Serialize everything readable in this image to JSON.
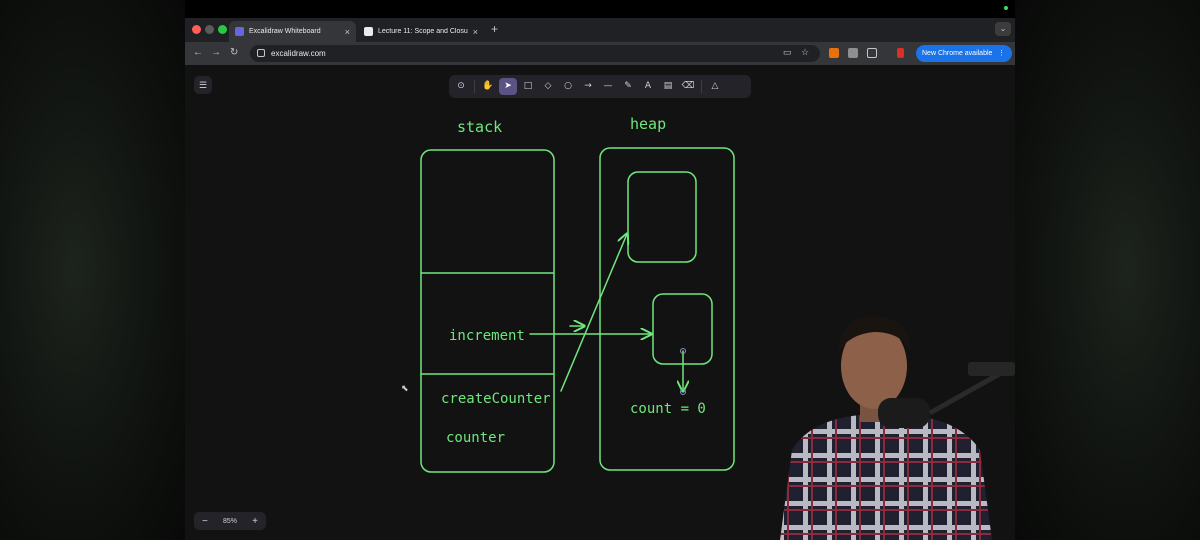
{
  "browser": {
    "tabs": [
      {
        "title": "Excalidraw Whiteboard",
        "active": true,
        "icon": "excalidraw-icon"
      },
      {
        "title": "Lecture 11: Scope and Closu",
        "active": false,
        "icon": "notion-icon"
      }
    ],
    "new_tab": "+",
    "url": "excalidraw.com",
    "update_button": "New Chrome available"
  },
  "excalidraw": {
    "menu_icon": "hamburger-icon",
    "tools": [
      "lock-icon",
      "hand-icon",
      "selection-icon",
      "rectangle-icon",
      "diamond-icon",
      "ellipse-icon",
      "arrow-icon",
      "line-icon",
      "draw-icon",
      "text-icon",
      "image-icon",
      "eraser-icon",
      "more-tools-icon"
    ],
    "selected_tool": "selection-icon",
    "zoom": "85%"
  },
  "drawing": {
    "stack_label": "stack",
    "heap_label": "heap",
    "increment_label": "increment",
    "create_counter_label": "createCounter",
    "counter_label": "counter",
    "count_label": "count = 0"
  },
  "colors": {
    "stroke": "#6ee87c",
    "accent_selected_tool": "#5a5384",
    "update_button": "#1a73e8"
  }
}
